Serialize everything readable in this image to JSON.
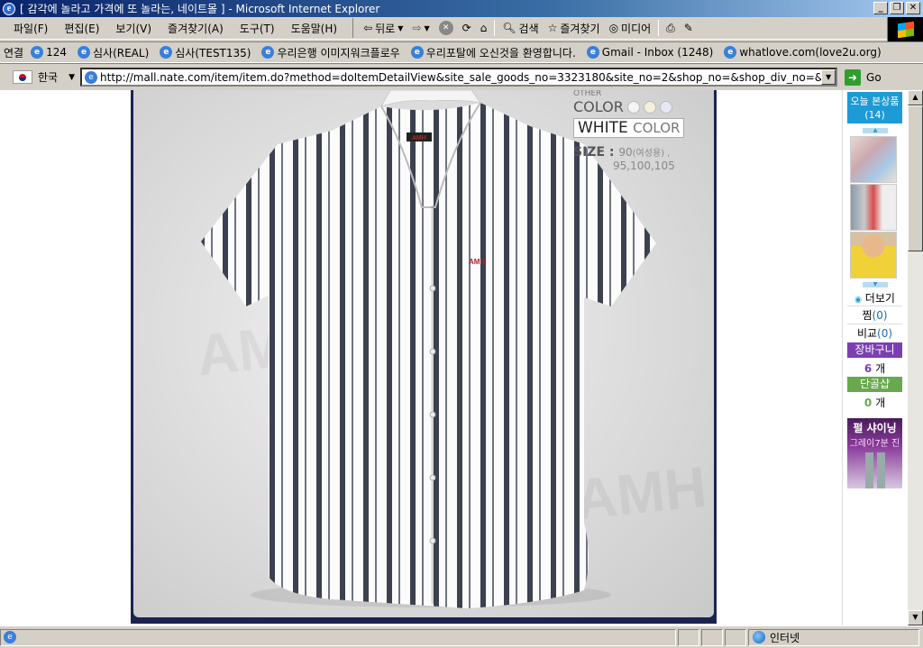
{
  "window": {
    "title": "[ 감각에 놀라고 가격에 또 놀라는, 네이트몰 ] - Microsoft Internet Explorer",
    "controls": {
      "minimize": "_",
      "restore": "❐",
      "close": "✕"
    }
  },
  "menu": {
    "items": [
      "파일(F)",
      "편집(E)",
      "보기(V)",
      "즐겨찾기(A)",
      "도구(T)",
      "도움말(H)"
    ]
  },
  "toolbar": {
    "back_label": "뒤로",
    "search_label": "검색",
    "favorites_label": "즐겨찾기",
    "media_label": "미디어"
  },
  "links": {
    "label": "연결",
    "items": [
      "124",
      "심사(REAL)",
      "심사(TEST135)",
      "우리은행 이미지워크플로우",
      "우리포탈에 오신것을 환영합니다.",
      "Gmail - Inbox (1248)",
      "whatlove.com(love2u.org)"
    ]
  },
  "address": {
    "language": "한국",
    "url": "http://mall.nate.com/item/item.do?method=doItemDetailView&site_sale_goods_no=3323180&site_no=2&shop_no=&shop_div_no=&market_no=&ma",
    "go_label": "Go"
  },
  "product": {
    "other_label": "OTHER",
    "color_label": "COLOR",
    "swatch_colors": [
      "#f4f4f4",
      "#f6efd8",
      "#e6e8f6"
    ],
    "selected_color": "WHITE",
    "selected_color_suffix": "COLOR",
    "size_label": "SIZE :",
    "size_line1": "90",
    "size_line1_note": "(여성용) ,",
    "size_line2": "95,100,105",
    "brand_tag": "AMH",
    "pocket_logo": "AMH",
    "watermark": "AMH"
  },
  "sidebar": {
    "today_title": "오늘 본상품",
    "today_count": "(14)",
    "more_label": "더보기",
    "wish_label": "찜",
    "wish_count": "(0)",
    "compare_label": "비교",
    "compare_count": "(0)",
    "cart_label": "장바구니",
    "cart_count": "6",
    "cart_unit": "개",
    "single_label": "단골샵",
    "single_count": "0",
    "single_unit": "개",
    "banner_line1": "펄 샤이닝",
    "banner_line2": "그레이7분 진"
  },
  "status": {
    "zone_label": "인터넷"
  },
  "colors": {
    "title_bar": "#0a246a",
    "frame_navy": "#1b2450",
    "today_blue": "#1e9ad6",
    "cart_purple": "#7b3fb2",
    "single_green": "#6aa84f"
  }
}
